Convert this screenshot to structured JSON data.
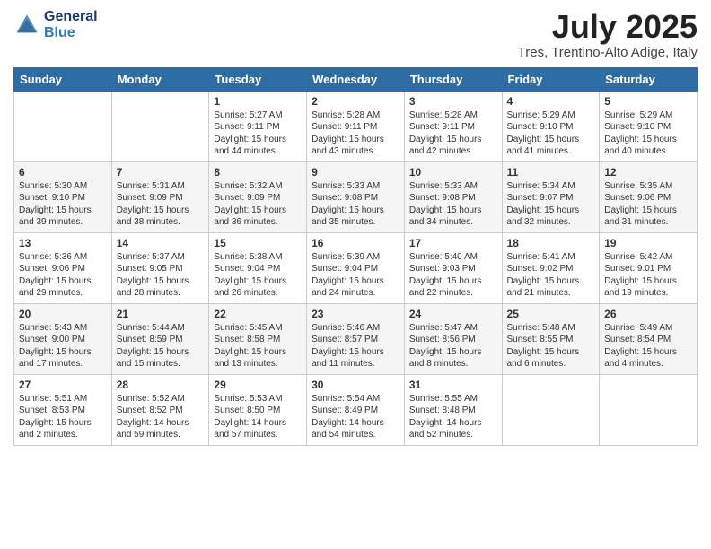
{
  "header": {
    "logo_line1": "General",
    "logo_line2": "Blue",
    "month": "July 2025",
    "location": "Tres, Trentino-Alto Adige, Italy"
  },
  "days_of_week": [
    "Sunday",
    "Monday",
    "Tuesday",
    "Wednesday",
    "Thursday",
    "Friday",
    "Saturday"
  ],
  "weeks": [
    [
      {
        "day": "",
        "info": ""
      },
      {
        "day": "",
        "info": ""
      },
      {
        "day": "1",
        "info": "Sunrise: 5:27 AM\nSunset: 9:11 PM\nDaylight: 15 hours\nand 44 minutes."
      },
      {
        "day": "2",
        "info": "Sunrise: 5:28 AM\nSunset: 9:11 PM\nDaylight: 15 hours\nand 43 minutes."
      },
      {
        "day": "3",
        "info": "Sunrise: 5:28 AM\nSunset: 9:11 PM\nDaylight: 15 hours\nand 42 minutes."
      },
      {
        "day": "4",
        "info": "Sunrise: 5:29 AM\nSunset: 9:10 PM\nDaylight: 15 hours\nand 41 minutes."
      },
      {
        "day": "5",
        "info": "Sunrise: 5:29 AM\nSunset: 9:10 PM\nDaylight: 15 hours\nand 40 minutes."
      }
    ],
    [
      {
        "day": "6",
        "info": "Sunrise: 5:30 AM\nSunset: 9:10 PM\nDaylight: 15 hours\nand 39 minutes."
      },
      {
        "day": "7",
        "info": "Sunrise: 5:31 AM\nSunset: 9:09 PM\nDaylight: 15 hours\nand 38 minutes."
      },
      {
        "day": "8",
        "info": "Sunrise: 5:32 AM\nSunset: 9:09 PM\nDaylight: 15 hours\nand 36 minutes."
      },
      {
        "day": "9",
        "info": "Sunrise: 5:33 AM\nSunset: 9:08 PM\nDaylight: 15 hours\nand 35 minutes."
      },
      {
        "day": "10",
        "info": "Sunrise: 5:33 AM\nSunset: 9:08 PM\nDaylight: 15 hours\nand 34 minutes."
      },
      {
        "day": "11",
        "info": "Sunrise: 5:34 AM\nSunset: 9:07 PM\nDaylight: 15 hours\nand 32 minutes."
      },
      {
        "day": "12",
        "info": "Sunrise: 5:35 AM\nSunset: 9:06 PM\nDaylight: 15 hours\nand 31 minutes."
      }
    ],
    [
      {
        "day": "13",
        "info": "Sunrise: 5:36 AM\nSunset: 9:06 PM\nDaylight: 15 hours\nand 29 minutes."
      },
      {
        "day": "14",
        "info": "Sunrise: 5:37 AM\nSunset: 9:05 PM\nDaylight: 15 hours\nand 28 minutes."
      },
      {
        "day": "15",
        "info": "Sunrise: 5:38 AM\nSunset: 9:04 PM\nDaylight: 15 hours\nand 26 minutes."
      },
      {
        "day": "16",
        "info": "Sunrise: 5:39 AM\nSunset: 9:04 PM\nDaylight: 15 hours\nand 24 minutes."
      },
      {
        "day": "17",
        "info": "Sunrise: 5:40 AM\nSunset: 9:03 PM\nDaylight: 15 hours\nand 22 minutes."
      },
      {
        "day": "18",
        "info": "Sunrise: 5:41 AM\nSunset: 9:02 PM\nDaylight: 15 hours\nand 21 minutes."
      },
      {
        "day": "19",
        "info": "Sunrise: 5:42 AM\nSunset: 9:01 PM\nDaylight: 15 hours\nand 19 minutes."
      }
    ],
    [
      {
        "day": "20",
        "info": "Sunrise: 5:43 AM\nSunset: 9:00 PM\nDaylight: 15 hours\nand 17 minutes."
      },
      {
        "day": "21",
        "info": "Sunrise: 5:44 AM\nSunset: 8:59 PM\nDaylight: 15 hours\nand 15 minutes."
      },
      {
        "day": "22",
        "info": "Sunrise: 5:45 AM\nSunset: 8:58 PM\nDaylight: 15 hours\nand 13 minutes."
      },
      {
        "day": "23",
        "info": "Sunrise: 5:46 AM\nSunset: 8:57 PM\nDaylight: 15 hours\nand 11 minutes."
      },
      {
        "day": "24",
        "info": "Sunrise: 5:47 AM\nSunset: 8:56 PM\nDaylight: 15 hours\nand 8 minutes."
      },
      {
        "day": "25",
        "info": "Sunrise: 5:48 AM\nSunset: 8:55 PM\nDaylight: 15 hours\nand 6 minutes."
      },
      {
        "day": "26",
        "info": "Sunrise: 5:49 AM\nSunset: 8:54 PM\nDaylight: 15 hours\nand 4 minutes."
      }
    ],
    [
      {
        "day": "27",
        "info": "Sunrise: 5:51 AM\nSunset: 8:53 PM\nDaylight: 15 hours\nand 2 minutes."
      },
      {
        "day": "28",
        "info": "Sunrise: 5:52 AM\nSunset: 8:52 PM\nDaylight: 14 hours\nand 59 minutes."
      },
      {
        "day": "29",
        "info": "Sunrise: 5:53 AM\nSunset: 8:50 PM\nDaylight: 14 hours\nand 57 minutes."
      },
      {
        "day": "30",
        "info": "Sunrise: 5:54 AM\nSunset: 8:49 PM\nDaylight: 14 hours\nand 54 minutes."
      },
      {
        "day": "31",
        "info": "Sunrise: 5:55 AM\nSunset: 8:48 PM\nDaylight: 14 hours\nand 52 minutes."
      },
      {
        "day": "",
        "info": ""
      },
      {
        "day": "",
        "info": ""
      }
    ]
  ]
}
